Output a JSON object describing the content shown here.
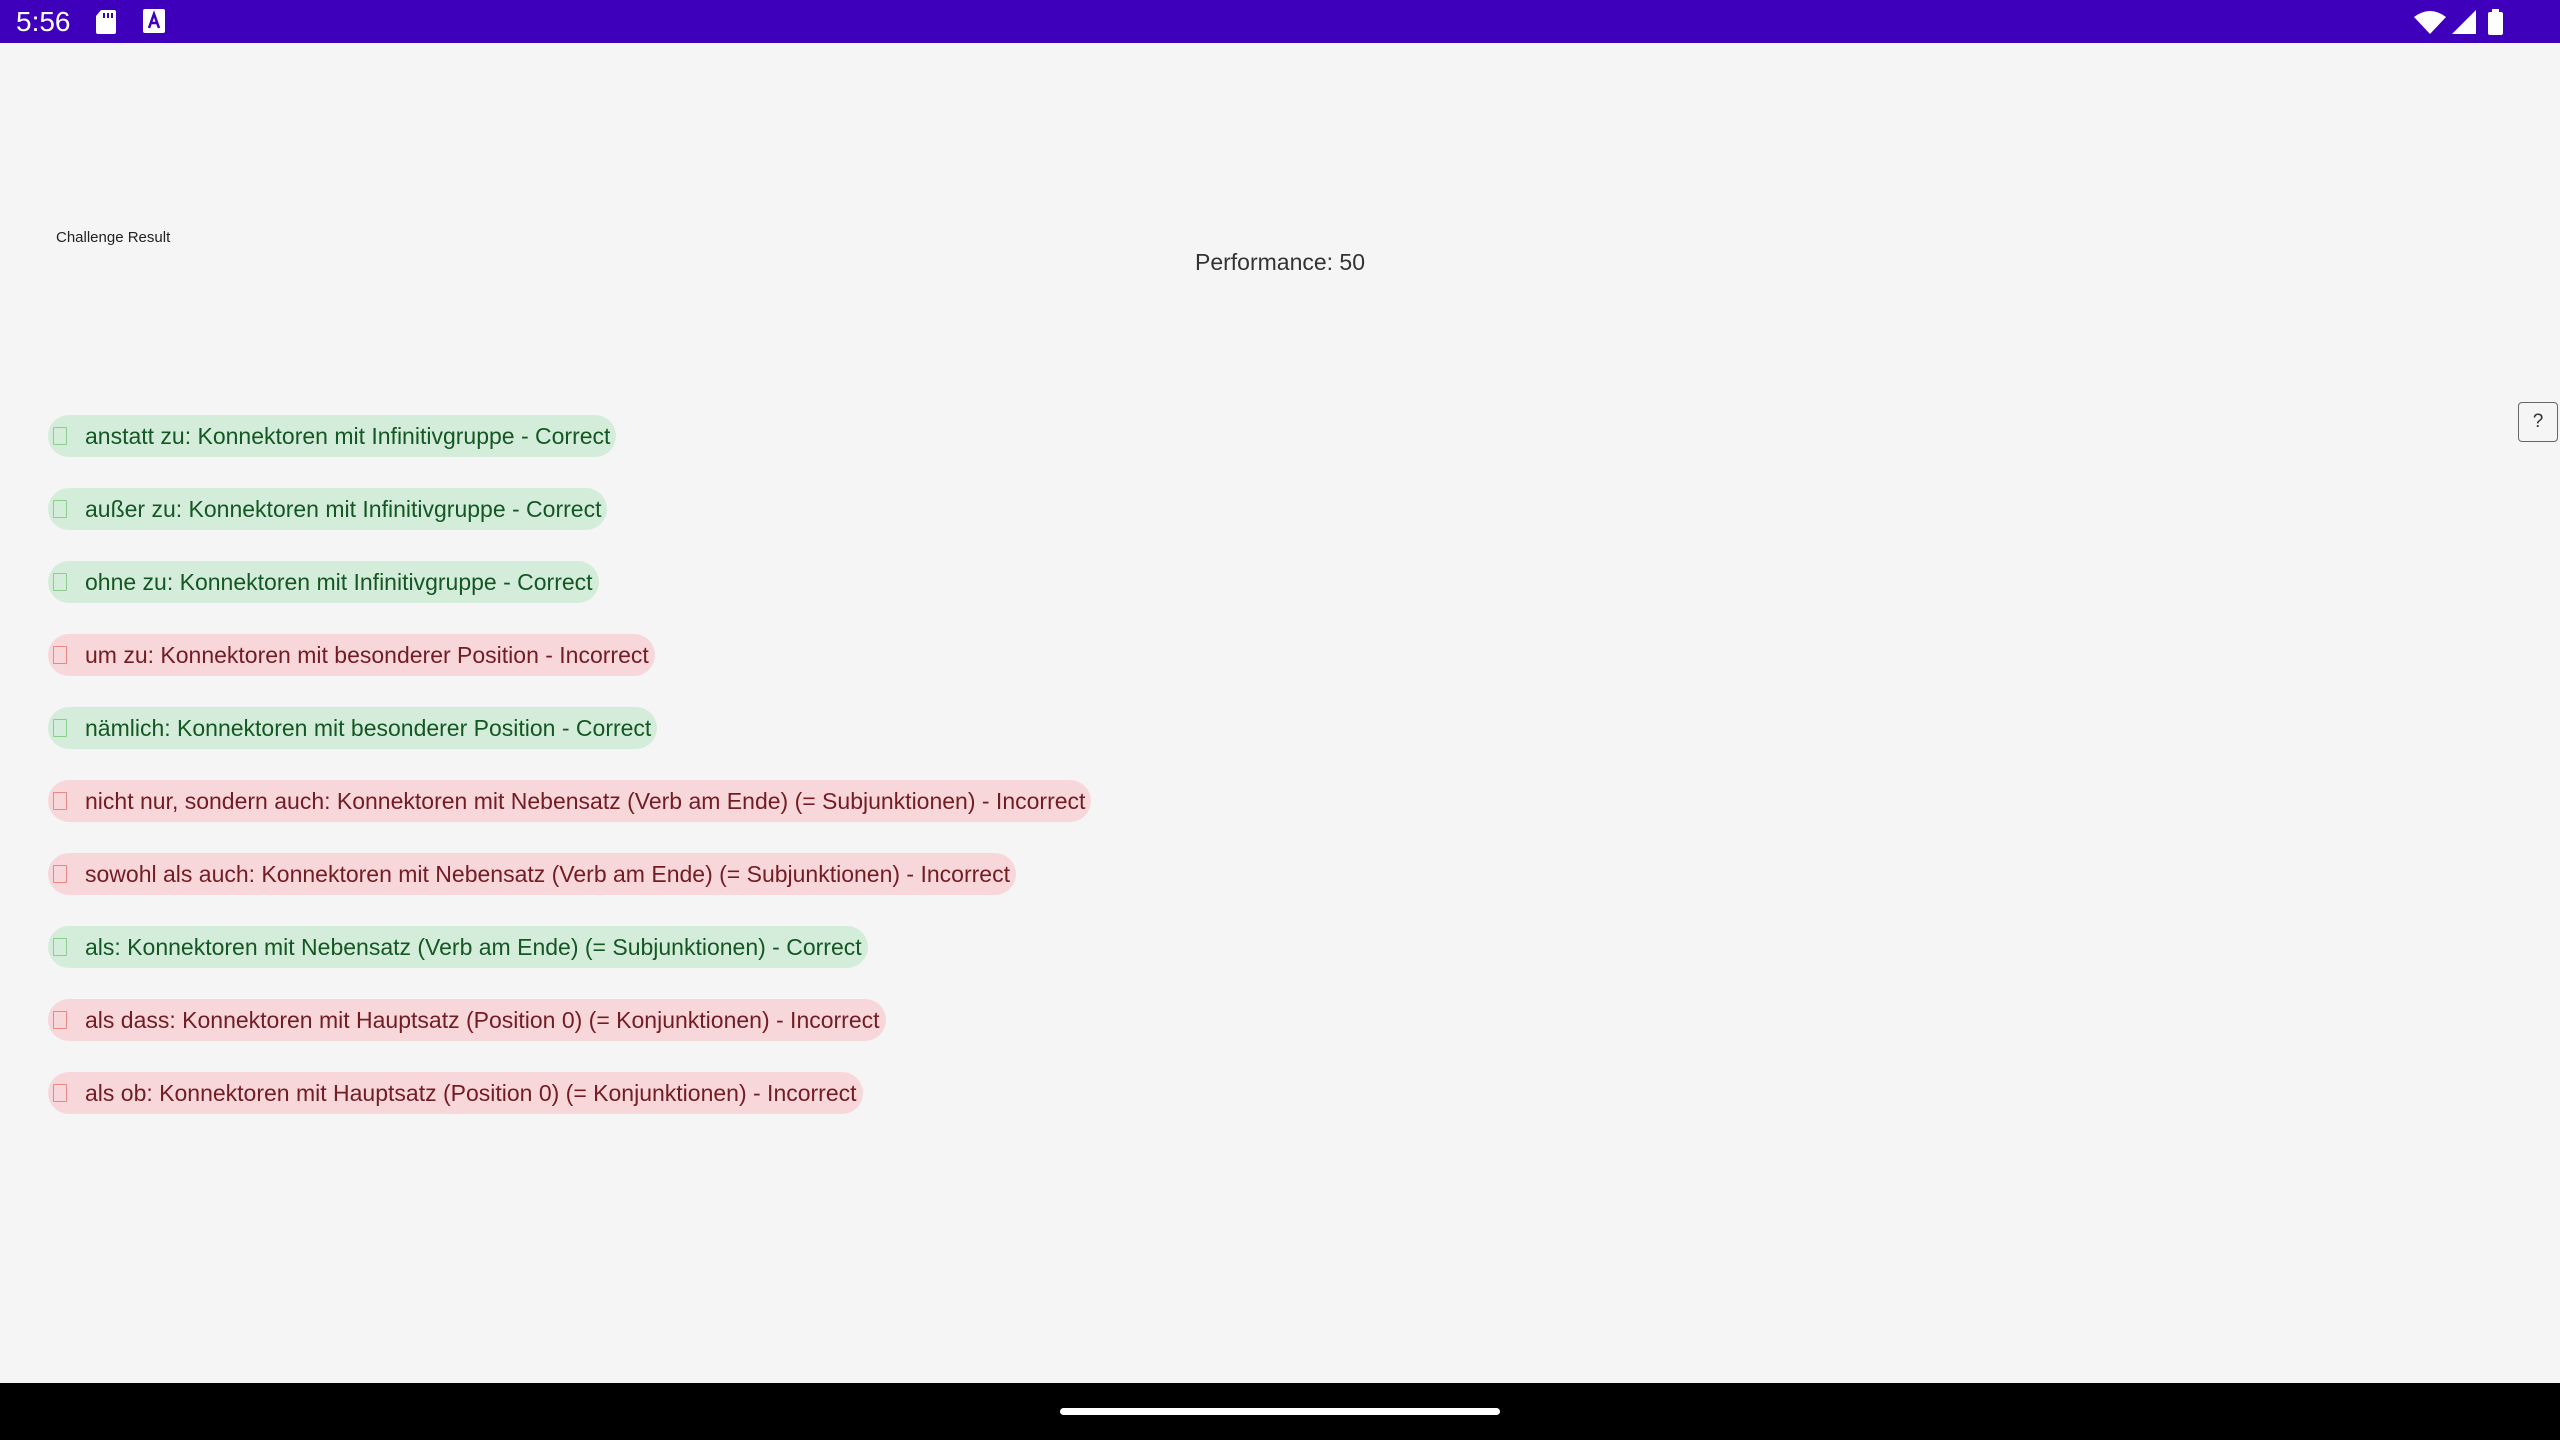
{
  "status_bar": {
    "time": "5:56",
    "icons": [
      "sd-card-icon",
      "text-a-icon",
      "wifi-icon",
      "cellular-signal-icon",
      "battery-icon"
    ]
  },
  "screen": {
    "title": "Challenge Result",
    "performance": "Performance: 50",
    "help_label": "?"
  },
  "results": [
    {
      "text": "anstatt zu: Konnektoren mit Infinitivgruppe - Correct",
      "status": "correct"
    },
    {
      "text": "außer zu: Konnektoren mit Infinitivgruppe - Correct",
      "status": "correct"
    },
    {
      "text": "ohne zu: Konnektoren mit Infinitivgruppe - Correct",
      "status": "correct"
    },
    {
      "text": "um zu: Konnektoren mit besonderer Position - Incorrect",
      "status": "incorrect"
    },
    {
      "text": "nämlich: Konnektoren mit besonderer Position - Correct",
      "status": "correct"
    },
    {
      "text": "nicht nur, sondern auch: Konnektoren mit Nebensatz (Verb am Ende) (= Subjunktionen) - Incorrect",
      "status": "incorrect"
    },
    {
      "text": "sowohl als auch: Konnektoren mit Nebensatz (Verb am Ende) (= Subjunktionen) - Incorrect",
      "status": "incorrect"
    },
    {
      "text": "als: Konnektoren mit Nebensatz (Verb am Ende) (= Subjunktionen) - Correct",
      "status": "correct"
    },
    {
      "text": "als dass: Konnektoren mit Hauptsatz (Position 0) (= Konjunktionen) - Incorrect",
      "status": "incorrect"
    },
    {
      "text": "als ob: Konnektoren mit Hauptsatz (Position 0) (= Konjunktionen) - Incorrect",
      "status": "incorrect"
    }
  ],
  "colors": {
    "status_bar": "#3f00bb",
    "background": "#f5f5f5",
    "correct_bg": "#d4edda",
    "correct_text": "#155724",
    "incorrect_bg": "#f8d7da",
    "incorrect_text": "#721c24",
    "nav_bar": "#000000"
  }
}
